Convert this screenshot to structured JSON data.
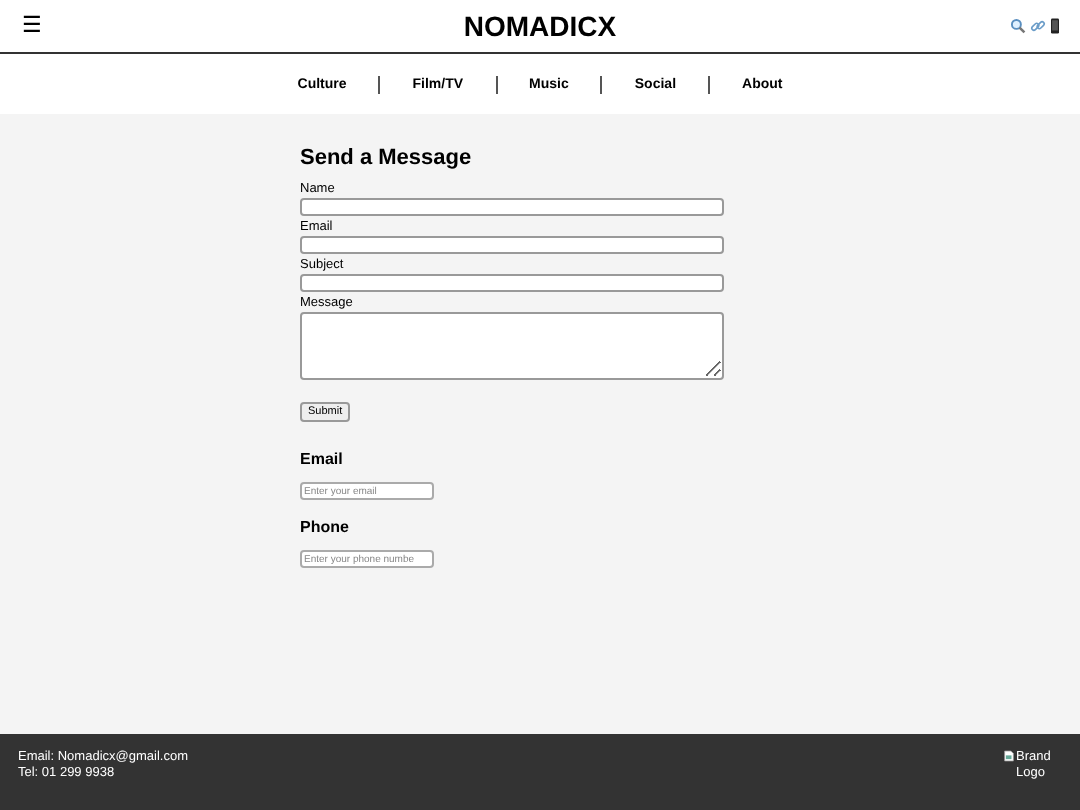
{
  "header": {
    "menu_glyph": "☰",
    "title": "NOMADICX"
  },
  "nav": [
    {
      "label": "Culture"
    },
    {
      "label": "Film/TV"
    },
    {
      "label": "Music"
    },
    {
      "label": "Social"
    },
    {
      "label": "About"
    }
  ],
  "contact_form": {
    "title": "Send a Message",
    "fields": [
      {
        "label": "Name",
        "kind": "line"
      },
      {
        "label": "Email",
        "kind": "line"
      },
      {
        "label": "Subject",
        "kind": "line"
      },
      {
        "label": "Message",
        "kind": "area"
      }
    ],
    "submit": "Submit"
  },
  "subscribe": [
    {
      "heading": "Email",
      "placeholder": "Enter your email"
    },
    {
      "heading": "Phone",
      "placeholder": "Enter your phone numbe"
    }
  ],
  "footer": {
    "lines": [
      "Email: Nomadicx@gmail.com",
      "Tel: 01 299 9938"
    ],
    "logo_alt": "Brand Logo"
  }
}
